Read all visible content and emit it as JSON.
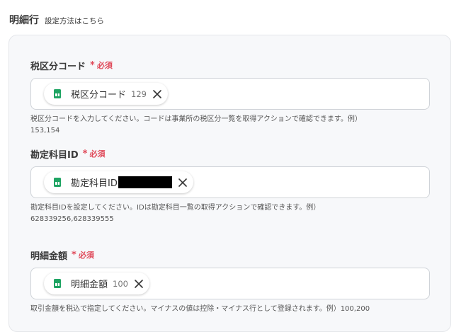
{
  "header": {
    "title": "明細行",
    "link": "設定方法はこちら"
  },
  "fields": [
    {
      "label": "税区分コード",
      "required_mark": "*",
      "required": "必須",
      "chip": {
        "label": "税区分コード",
        "value": "129"
      },
      "help": "税区分コードを入力してください。コードは事業所の税区分一覧を取得アクションで確認できます。例）153,154"
    },
    {
      "label": "勘定科目ID",
      "required_mark": "*",
      "required": "必須",
      "chip": {
        "label": "勘定科目ID",
        "value": ""
      },
      "help": "勘定科目IDを設定してください。IDは勘定科目一覧の取得アクションで確認できます。例）628339256,628339555"
    },
    {
      "label": "明細金額",
      "required_mark": "*",
      "required": "必須",
      "chip": {
        "label": "明細金額",
        "value": "100"
      },
      "help": "取引金額を税込で指定してください。マイナスの値は控除・マイナス行として登録されます。例）100,200"
    }
  ],
  "icons": {
    "chip": "spreadsheet-icon",
    "remove": "close-icon"
  },
  "colors": {
    "required": "#e04a5a",
    "sheet": "#1fa463",
    "panel": "#f7f8fa"
  }
}
